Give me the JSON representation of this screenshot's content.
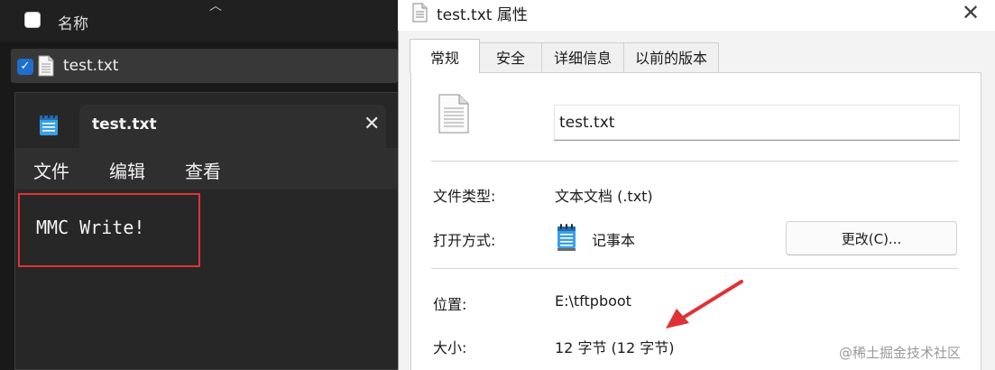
{
  "explorer": {
    "column_header": "名称",
    "file_name": "test.txt"
  },
  "notepad": {
    "tab_title": "test.txt",
    "menu": [
      "文件",
      "编辑",
      "查看"
    ],
    "content": "MMC Write!"
  },
  "properties": {
    "title": "test.txt 属性",
    "tabs": [
      "常规",
      "安全",
      "详细信息",
      "以前的版本"
    ],
    "file_name": "test.txt",
    "type_label": "文件类型:",
    "type_value": "文本文档 (.txt)",
    "open_label": "打开方式:",
    "open_value": "记事本",
    "change_button": "更改(C)...",
    "location_label": "位置:",
    "location_value": "E:\\tftpboot",
    "size_label": "大小:",
    "size_value": "12 字节 (12 字节)"
  },
  "watermark": "@稀土掘金技术社区",
  "colors": {
    "highlight": "#e03236",
    "checkbox_accent": "#1f6fd1"
  }
}
